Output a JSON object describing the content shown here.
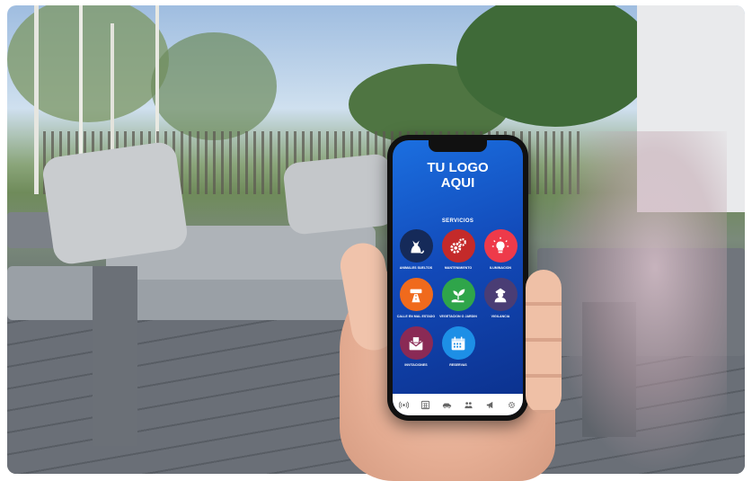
{
  "app": {
    "logo_text_line1": "TU LOGO",
    "logo_text_line2": "AQUI",
    "section_title": "SERVICIOS"
  },
  "services": [
    {
      "label": "ANIMALES SUELTOS",
      "icon": "cat-icon",
      "color": "#152a59"
    },
    {
      "label": "MANTENIMIENTO",
      "icon": "gears-icon",
      "color": "#c42a2a"
    },
    {
      "label": "ILUMINACION",
      "icon": "lightbulb-icon",
      "color": "#ee3a4a"
    },
    {
      "label": "CALLE EN MAL ESTADO",
      "icon": "road-icon",
      "color": "#f06a1c"
    },
    {
      "label": "VEGETACION O JARDIN",
      "icon": "plant-icon",
      "color": "#2fa54a"
    },
    {
      "label": "VIGILANCIA",
      "icon": "guard-icon",
      "color": "#4a3d74"
    },
    {
      "label": "INVITACIONES",
      "icon": "envelope-icon",
      "color": "#8a2a55"
    },
    {
      "label": "RESERVAS",
      "icon": "calendar-icon",
      "color": "#1d8fe6"
    }
  ],
  "tabbar": [
    "radio-icon",
    "calculator-icon",
    "car-icon",
    "people-icon",
    "megaphone-icon",
    "settings-icon"
  ]
}
